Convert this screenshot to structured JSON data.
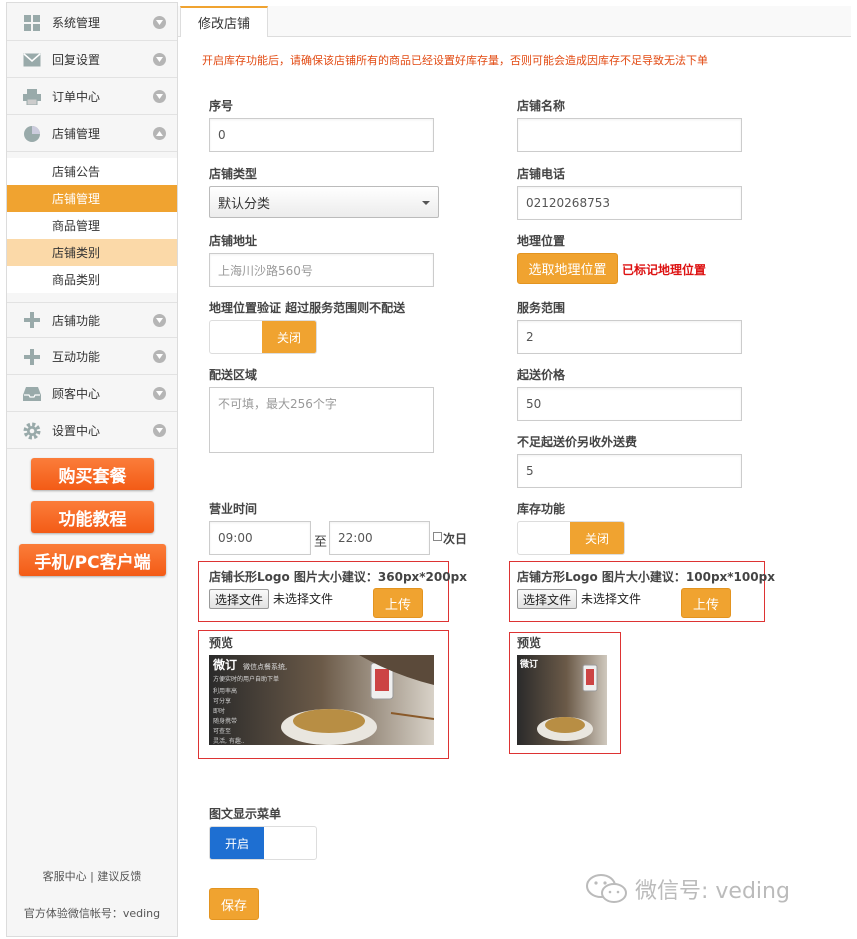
{
  "sidebar": {
    "menu": [
      {
        "label": "系统管理",
        "icon": "grid-icon"
      },
      {
        "label": "回复设置",
        "icon": "mail-icon"
      },
      {
        "label": "订单中心",
        "icon": "printer-icon"
      },
      {
        "label": "店铺管理",
        "icon": "pie-chart-icon"
      }
    ],
    "sub": [
      {
        "label": "店铺公告"
      },
      {
        "label": "店铺管理"
      },
      {
        "label": "商品管理"
      },
      {
        "label": "店铺类别"
      },
      {
        "label": "商品类别"
      }
    ],
    "menu2": [
      {
        "label": "店铺功能",
        "icon": "plus-icon"
      },
      {
        "label": "互动功能",
        "icon": "plus-icon"
      },
      {
        "label": "顾客中心",
        "icon": "inbox-icon"
      },
      {
        "label": "设置中心",
        "icon": "gear-icon"
      }
    ],
    "promo": [
      "购买套餐",
      "功能教程",
      "手机/PC客户端"
    ],
    "footer_links": "客服中心 | 建议反馈",
    "footer_account": "官方体验微信帐号：veding"
  },
  "tab": {
    "label": "修改店铺"
  },
  "notice": "开启库存功能后，请确保该店铺所有的商品已经设置好库存量，否则可能会造成因库存不足导致无法下单",
  "form": {
    "seq_label": "序号",
    "seq_value": "0",
    "name_label": "店铺名称",
    "name_value": "",
    "type_label": "店铺类型",
    "type_value": "默认分类",
    "phone_label": "店铺电话",
    "phone_value": "02120268753",
    "address_label": "店铺地址",
    "address_value": "上海川沙路560号",
    "geo_label": "地理位置",
    "geo_button": "选取地理位置",
    "geo_status": "已标记地理位置",
    "geo_verify_label": "地理位置验证 超过服务范围则不配送",
    "geo_verify_toggle": "关闭",
    "range_label": "服务范围",
    "range_value": "2",
    "area_label": "配送区域",
    "area_placeholder": "不可填，最大256个字",
    "min_price_label": "起送价格",
    "min_price_value": "50",
    "extra_fee_label": "不足起送价另收外送费",
    "extra_fee_value": "5",
    "hours_label": "营业时间",
    "hours_start": "09:00",
    "hours_sep": "至",
    "hours_end": "22:00",
    "next_day": "次日",
    "stock_label": "库存功能",
    "stock_toggle": "关闭",
    "logo_long_label": "店铺长形Logo 图片大小建议：360px*200px",
    "logo_square_label": "店铺方形Logo 图片大小建议：100px*100px",
    "choose_file": "选择文件",
    "no_file": "未选择文件",
    "upload": "上传",
    "preview": "预览",
    "menu_display_label": "图文显示菜单",
    "menu_display_toggle": "开启",
    "save": "保存"
  },
  "preview_text": {
    "title": "微订",
    "lines": [
      "微信点餐系统,",
      "方便实时的用户自助下单",
      "利用率高",
      "可分享",
      "即时",
      "随身携带",
      "可查至",
      "灵活, 有趣.."
    ]
  },
  "watermark": "微信号: veding",
  "colors": {
    "accent": "#f0a330",
    "notice": "#e24a12",
    "promo": "#f35b16",
    "on": "#1e6fd2"
  }
}
